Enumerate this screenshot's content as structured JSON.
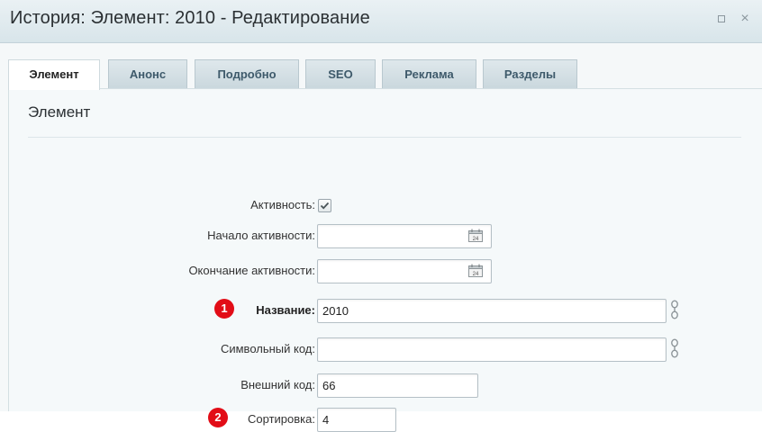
{
  "window": {
    "title": "История: Элемент: 2010 - Редактирование",
    "maximize_label": "",
    "close_label": "×"
  },
  "tabs": [
    {
      "label": "Элемент",
      "active": true
    },
    {
      "label": "Анонс",
      "active": false
    },
    {
      "label": "Подробно",
      "active": false
    },
    {
      "label": "SEO",
      "active": false
    },
    {
      "label": "Реклама",
      "active": false
    },
    {
      "label": "Разделы",
      "active": false
    }
  ],
  "section": {
    "title": "Элемент"
  },
  "form": {
    "active": {
      "label": "Активность:",
      "checked": true
    },
    "active_from": {
      "label": "Начало активности:",
      "value": "",
      "calendar_day": "24"
    },
    "active_to": {
      "label": "Окончание активности:",
      "value": "",
      "calendar_day": "24"
    },
    "name": {
      "label": "Название:",
      "value": "2010"
    },
    "code": {
      "label": "Символьный код:",
      "value": ""
    },
    "external_code": {
      "label": "Внешний код:",
      "value": "66"
    },
    "sort": {
      "label": "Сортировка:",
      "value": "4"
    }
  },
  "badges": [
    "1",
    "2"
  ],
  "colors": {
    "badge": "#e20d17",
    "titlebar": "#dce7ec",
    "panel": "#f5f9fa"
  }
}
